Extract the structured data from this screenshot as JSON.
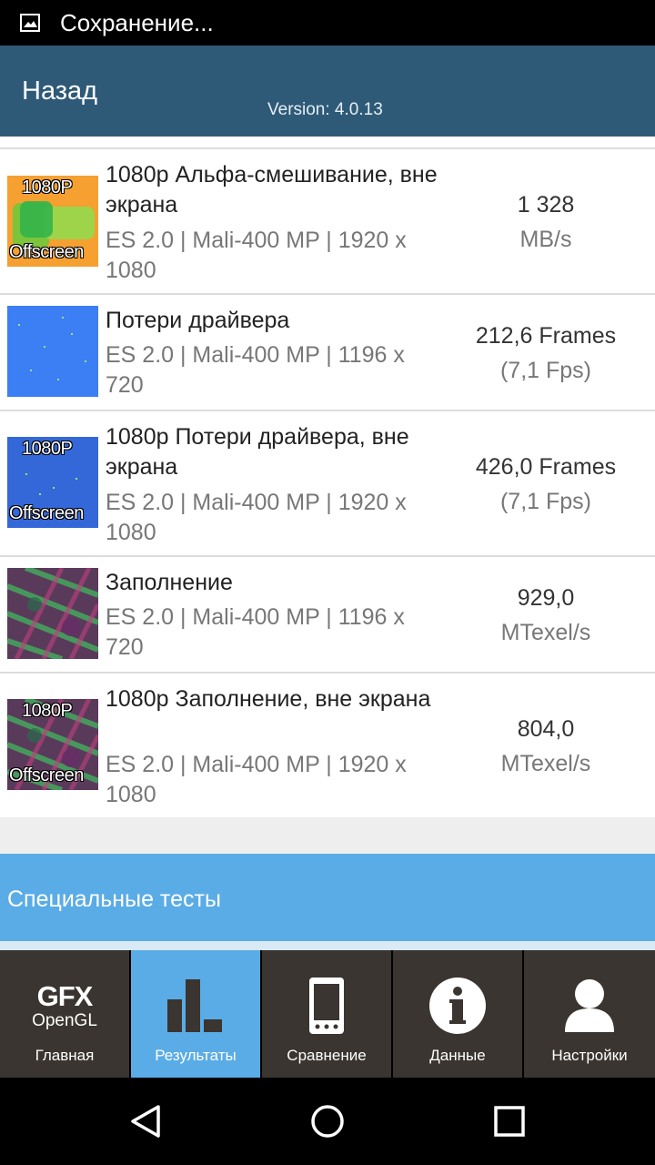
{
  "status_bar": {
    "text": "Сохранение..."
  },
  "header": {
    "back_label": "Назад",
    "version": "Version: 4.0.13"
  },
  "results": [
    {
      "thumb": "orange-green",
      "top_tag": "1080P",
      "bottom_tag": "Offscreen",
      "title": "1080p Альфа-смешивание, вне экрана",
      "subtitle": "ES 2.0 | Mali-400 MP | 1920 x 1080",
      "value": "1 328",
      "unit": "MB/s"
    },
    {
      "thumb": "blue",
      "top_tag": "",
      "bottom_tag": "",
      "title": "Потери драйвера",
      "subtitle": "ES 2.0 | Mali-400 MP | 1196 x 720",
      "value": "212,6 Frames",
      "unit": "(7,1 Fps)"
    },
    {
      "thumb": "blue-dark",
      "top_tag": "1080P",
      "bottom_tag": "Offscreen",
      "title": "1080p Потери драйвера, вне экрана",
      "subtitle": "ES 2.0 | Mali-400 MP | 1920 x 1080",
      "value": "426,0 Frames",
      "unit": "(7,1 Fps)"
    },
    {
      "thumb": "noise",
      "top_tag": "",
      "bottom_tag": "",
      "title": "Заполнение",
      "subtitle": "ES 2.0 | Mali-400 MP | 1196 x 720",
      "value": "929,0",
      "unit": "MTexel/s"
    },
    {
      "thumb": "noise",
      "top_tag": "1080P",
      "bottom_tag": "Offscreen",
      "title": "1080p Заполнение, вне экрана",
      "subtitle": "ES 2.0 | Mali-400 MP | 1920 x 1080",
      "value": "804,0",
      "unit": "MTexel/s"
    }
  ],
  "section": {
    "label": "Специальные тесты"
  },
  "tabs": {
    "logo_main": "GFX",
    "logo_sub": "OpenGL",
    "items": [
      {
        "label": "Главная",
        "icon": "gfx-logo-icon"
      },
      {
        "label": "Результаты",
        "icon": "bar-chart-icon"
      },
      {
        "label": "Сравнение",
        "icon": "phone-icon"
      },
      {
        "label": "Данные",
        "icon": "info-icon"
      },
      {
        "label": "Настройки",
        "icon": "user-icon"
      }
    ],
    "active_index": 1
  },
  "colors": {
    "header": "#2e5a78",
    "accent": "#5aace6",
    "tab_bg": "#3a3530"
  }
}
